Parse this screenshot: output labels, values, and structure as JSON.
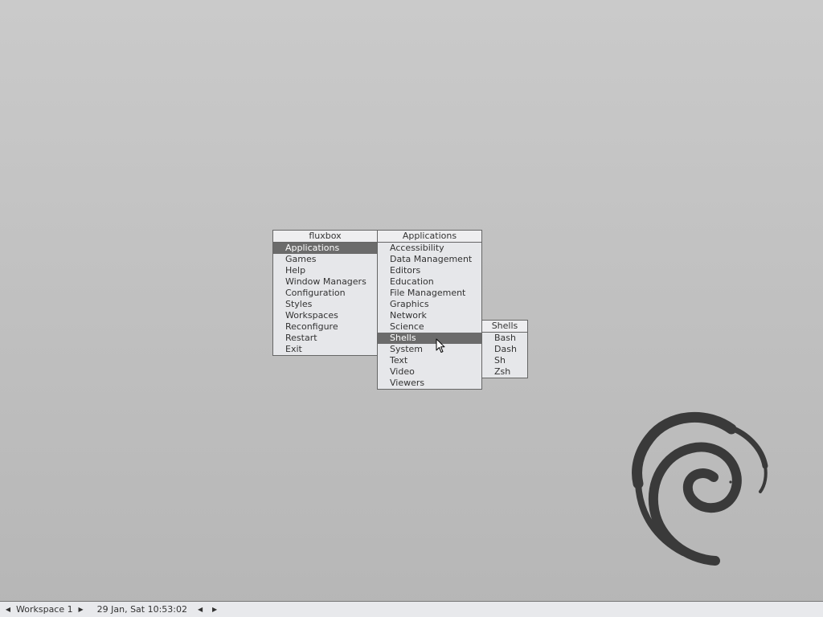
{
  "root_menu": {
    "title": "fluxbox",
    "items": [
      {
        "label": "Applications",
        "active": true
      },
      {
        "label": "Games"
      },
      {
        "label": "Help"
      },
      {
        "label": "Window Managers"
      },
      {
        "label": "Configuration"
      },
      {
        "label": "Styles"
      },
      {
        "label": "Workspaces"
      },
      {
        "label": "Reconfigure"
      },
      {
        "label": "Restart"
      },
      {
        "label": "Exit"
      }
    ]
  },
  "applications_menu": {
    "title": "Applications",
    "items": [
      {
        "label": "Accessibility"
      },
      {
        "label": "Data Management"
      },
      {
        "label": "Editors"
      },
      {
        "label": "Education"
      },
      {
        "label": "File Management"
      },
      {
        "label": "Graphics"
      },
      {
        "label": "Network"
      },
      {
        "label": "Science"
      },
      {
        "label": "Shells",
        "active": true
      },
      {
        "label": "System"
      },
      {
        "label": "Text"
      },
      {
        "label": "Video"
      },
      {
        "label": "Viewers"
      }
    ]
  },
  "shells_menu": {
    "title": "Shells",
    "items": [
      {
        "label": "Bash"
      },
      {
        "label": "Dash"
      },
      {
        "label": "Sh"
      },
      {
        "label": "Zsh"
      }
    ]
  },
  "toolbar": {
    "prev_icon": "triangle-left-icon",
    "next_icon": "triangle-right-icon",
    "workspace": "Workspace 1",
    "clock": "29 Jan, Sat 10:53:02"
  },
  "colors": {
    "desktop_top": "#cacaca",
    "desktop_bottom": "#b6b6b6",
    "menu_bg": "#e6e7ea",
    "menu_highlight": "#6b6b6b",
    "logo": "#3a3a3a"
  }
}
